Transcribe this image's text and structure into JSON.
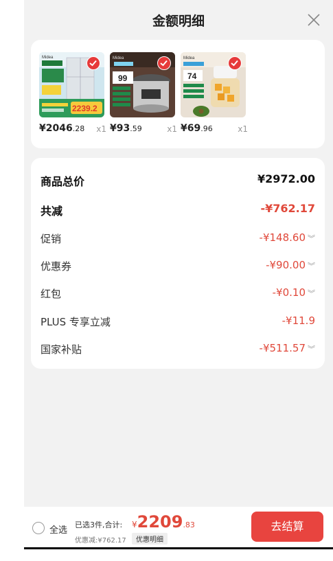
{
  "header": {
    "title": "金额明细"
  },
  "products": [
    {
      "price_int": "¥2046",
      "price_dec": ".28",
      "qty": "x1",
      "promo_price": "2239.2",
      "brand": "Midea"
    },
    {
      "price_int": "¥93",
      "price_dec": ".59",
      "qty": "x1",
      "promo_price": "99",
      "brand": "Midea"
    },
    {
      "price_int": "¥69",
      "price_dec": ".96",
      "qty": "x1",
      "promo_price": "74",
      "brand": "Midea"
    }
  ],
  "summary": {
    "rows": [
      {
        "label": "商品总价",
        "value": "¥2972.00"
      },
      {
        "label": "共减",
        "value": "-¥762.17"
      },
      {
        "label": "促销",
        "value": "-¥148.60"
      },
      {
        "label": "优惠券",
        "value": "-¥90.00"
      },
      {
        "label": "红包",
        "value": "-¥0.10"
      },
      {
        "label": "PLUS 专享立减",
        "value": "-¥11.9"
      },
      {
        "label": "国家补贴",
        "value": "-¥511.57"
      }
    ]
  },
  "bottom": {
    "select_all": "全选",
    "selected_text": "已选3件,合计:",
    "currency": "¥",
    "total_int": "2209",
    "total_dec": ".83",
    "discount_text": "优惠减:¥762.17",
    "detail_label": "优惠明细",
    "checkout_label": "去结算"
  },
  "colors": {
    "accent": "#e0483a",
    "checkout": "#e8443f"
  }
}
